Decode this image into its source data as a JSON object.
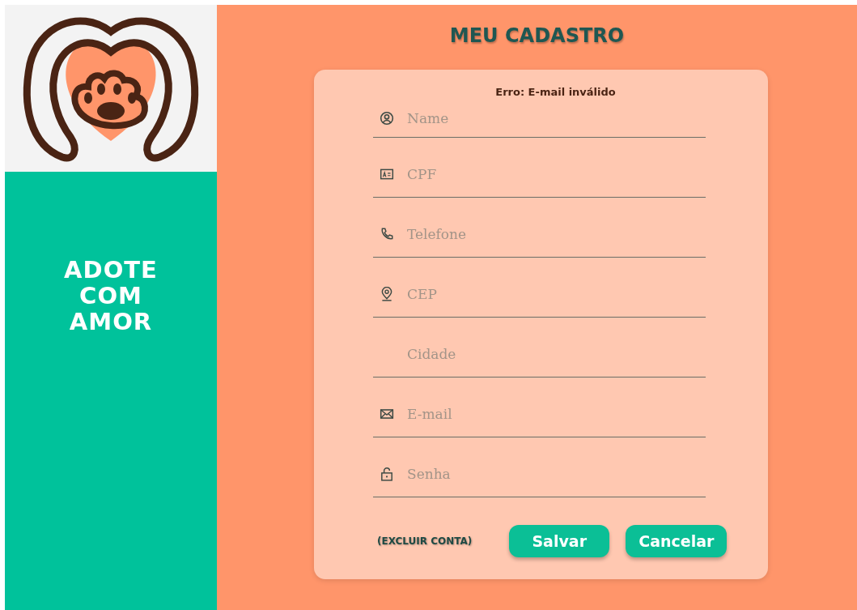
{
  "sidebar": {
    "brand_lines": [
      "ADOTE",
      "COM",
      "AMOR"
    ]
  },
  "page": {
    "title": "MEU CADASTRO"
  },
  "form": {
    "error": "Erro: E-mail inválido",
    "fields": [
      {
        "kind": "person",
        "placeholder": "Name"
      },
      {
        "kind": "id-card",
        "placeholder": "CPF"
      },
      {
        "kind": "phone",
        "placeholder": "Telefone"
      },
      {
        "kind": "pin",
        "placeholder": "CEP"
      },
      {
        "kind": "none",
        "placeholder": "Cidade"
      },
      {
        "kind": "mail",
        "placeholder": "E-mail"
      },
      {
        "kind": "lock",
        "placeholder": "Senha"
      }
    ],
    "delete_link": "(EXCLUIR CONTA)",
    "buttons": [
      "Salvar",
      "Cancelar"
    ]
  }
}
